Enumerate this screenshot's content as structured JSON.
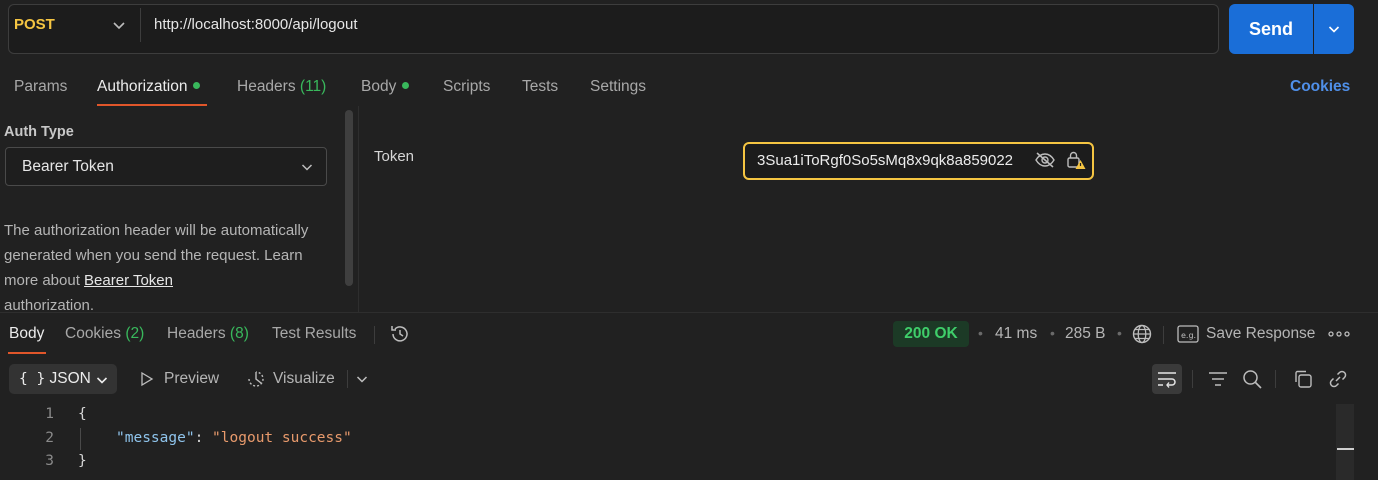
{
  "request": {
    "method": "POST",
    "url": "http://localhost:8000/api/logout",
    "send_label": "Send"
  },
  "request_tabs": {
    "params": "Params",
    "authorization": "Authorization",
    "headers": "Headers",
    "headers_count": "(11)",
    "body": "Body",
    "scripts": "Scripts",
    "tests": "Tests",
    "settings": "Settings",
    "cookies": "Cookies"
  },
  "auth": {
    "type_label": "Auth Type",
    "type_value": "Bearer Token",
    "desc_1": "The authorization header will be automatically generated when you send the request. Learn more about ",
    "desc_link": "Bearer Token",
    "desc_2": "authorization.",
    "token_label": "Token",
    "token_value": "3Sua1iToRgf0So5sMq8x9qk8a859022"
  },
  "response_tabs": {
    "body": "Body",
    "cookies": "Cookies",
    "cookies_count": "(2)",
    "headers": "Headers",
    "headers_count": "(8)",
    "test_results": "Test Results"
  },
  "response_meta": {
    "status": "200 OK",
    "time": "41 ms",
    "size": "285 B",
    "save_response": "Save Response"
  },
  "response_toolbar": {
    "format": "JSON",
    "preview": "Preview",
    "visualize": "Visualize"
  },
  "response_body": {
    "line_numbers": [
      "1",
      "2",
      "3"
    ],
    "open_brace": "{",
    "key": "\"message\"",
    "colon": ": ",
    "value": "\"logout success\"",
    "close_brace": "}"
  },
  "colors": {
    "method": "#f5c542",
    "send": "#1a6ed8",
    "active_tab_underline": "#e0562a",
    "status_ok": "#3fce6a",
    "link": "#4f8fe8"
  }
}
